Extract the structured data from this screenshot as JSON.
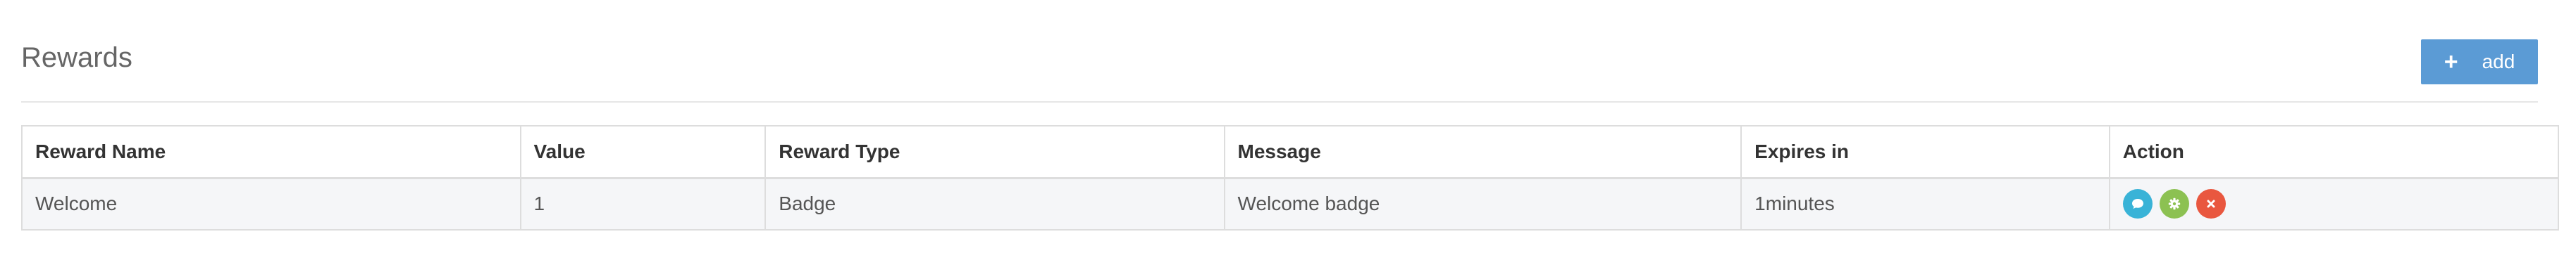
{
  "header": {
    "title": "Rewards",
    "add_label": "add"
  },
  "table": {
    "columns": [
      "Reward Name",
      "Value",
      "Reward Type",
      "Message",
      "Expires in",
      "Action"
    ],
    "rows": [
      {
        "reward_name": "Welcome",
        "value": "1",
        "reward_type": "Badge",
        "message": "Welcome badge",
        "expires_in": "1minutes",
        "actions": [
          {
            "icon": "message-icon",
            "color": "#39b3d7"
          },
          {
            "icon": "gear-icon",
            "color": "#8cc152"
          },
          {
            "icon": "close-icon",
            "color": "#e9573f"
          }
        ]
      }
    ]
  },
  "colors": {
    "primary": "#5b9bd5",
    "info": "#39b3d7",
    "success": "#8cc152",
    "danger": "#e9573f"
  }
}
